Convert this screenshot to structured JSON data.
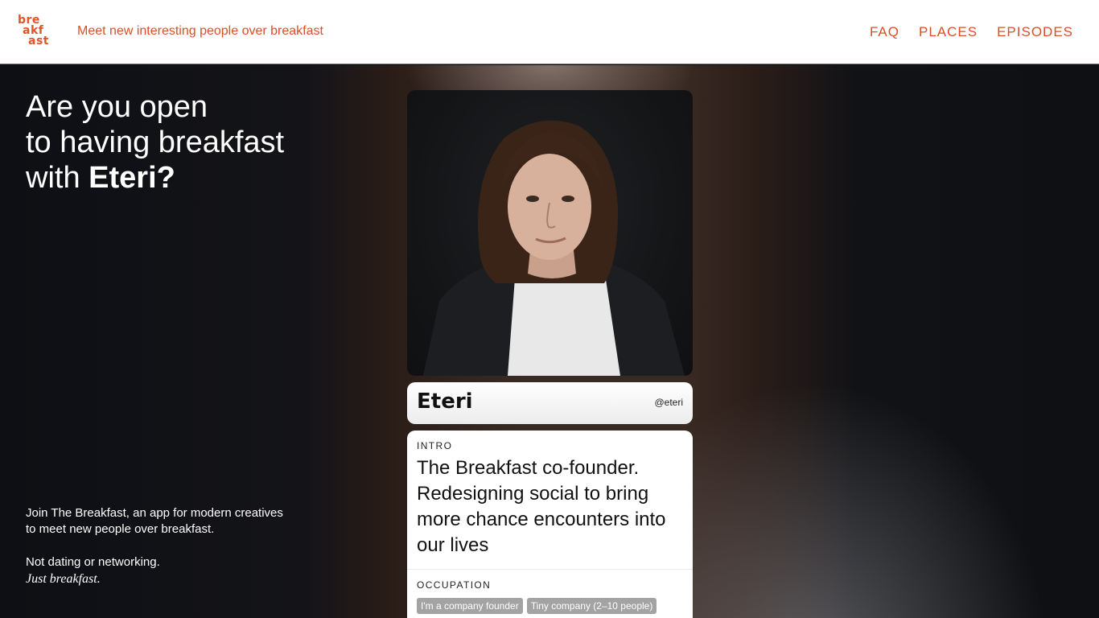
{
  "header": {
    "logo_lines": [
      "bre",
      "akf",
      "ast"
    ],
    "tagline": "Meet new interesting people over breakfast",
    "nav": [
      "FAQ",
      "PLACES",
      "EPISODES"
    ]
  },
  "hero": {
    "headline_line1": "Are you open",
    "headline_line2": "to having breakfast",
    "headline_line3_prefix": "with ",
    "headline_name": "Eteri?",
    "join_line1": "Join The Breakfast, an app for modern creatives",
    "join_line2": "to meet new people over breakfast.",
    "not_dating": "Not dating or networking.",
    "just_breakfast": "Just breakfast."
  },
  "profile": {
    "name": "Eteri",
    "handle": "@eteri",
    "intro_label": "INTRO",
    "intro_text": "The Breakfast co-founder. Redesigning social to bring more chance encounters into our lives",
    "occupation_label": "OCCUPATION",
    "tags": [
      "I'm a company founder",
      "Tiny company (2–10 people)"
    ]
  },
  "colors": {
    "accent": "#d94f26",
    "background": "#0e0f13"
  }
}
